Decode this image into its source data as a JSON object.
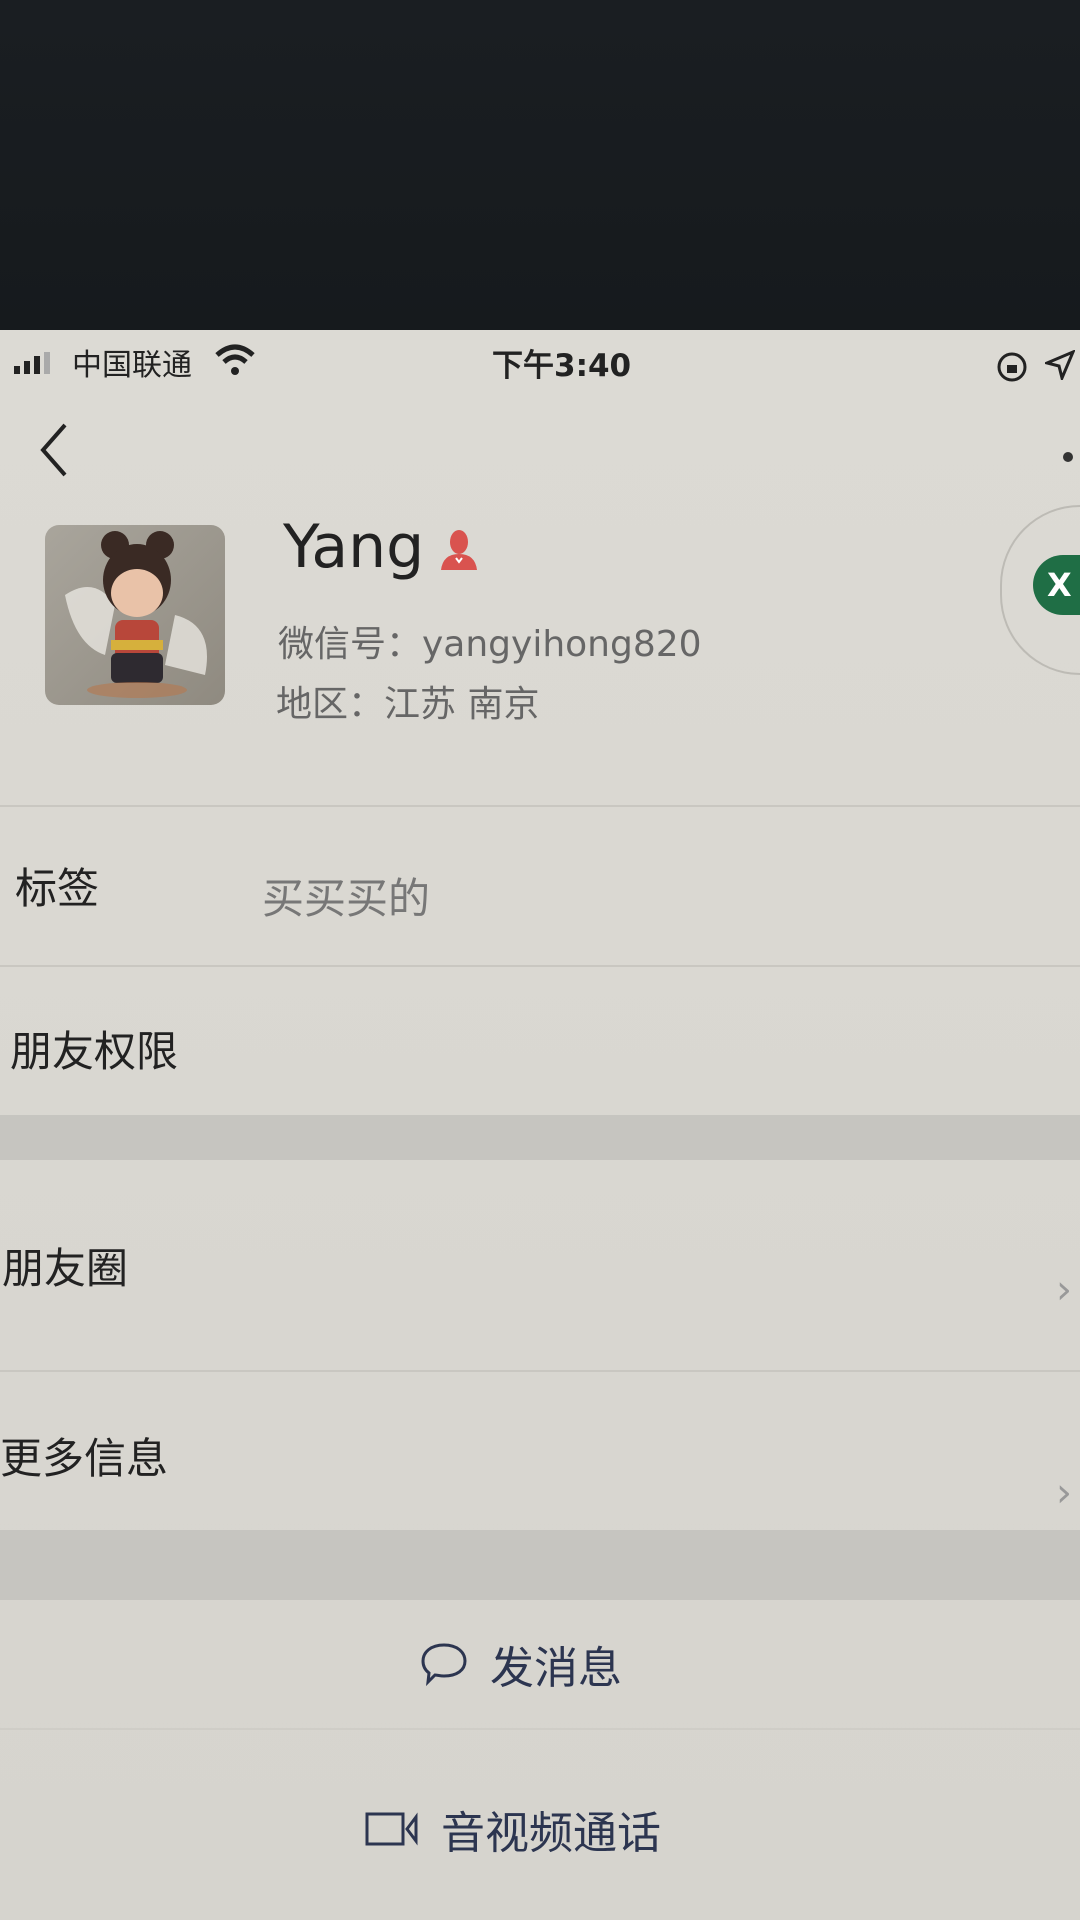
{
  "status_bar": {
    "carrier": "中国联通",
    "time": "下午3:40"
  },
  "profile": {
    "name": "Yang",
    "wechat_id": "微信号：yangyihong820",
    "region": "地区：江苏 南京"
  },
  "rows": {
    "tags_label": "标签",
    "tags_value": "买买买的",
    "friend_permissions": "朋友权限",
    "moments": "朋友圈",
    "more_info": "更多信息"
  },
  "actions": {
    "message": "发消息",
    "call": "音视频通话"
  },
  "floating_bubble": {
    "letter": "X"
  },
  "colors": {
    "accent_text": "#2c3550",
    "gender_icon": "#d9534f",
    "bubble_green": "#1f6e45"
  }
}
